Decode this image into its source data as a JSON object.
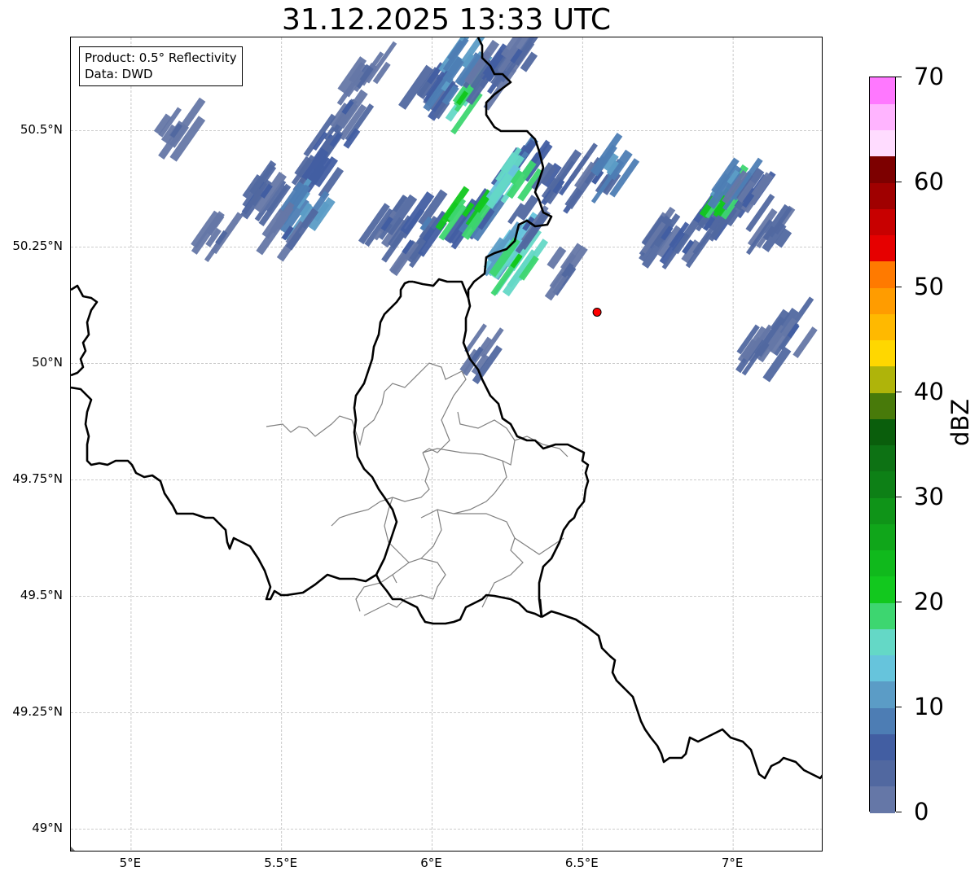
{
  "title": "31.12.2025 13:33 UTC",
  "info_box": {
    "product": "Product: 0.5° Reflectivity",
    "source": "Data: DWD"
  },
  "map": {
    "lon_range": [
      4.8,
      7.3
    ],
    "lat_range": [
      48.95,
      50.7
    ],
    "lat_ticks": [
      {
        "value": 50.5,
        "label": "50.5°N"
      },
      {
        "value": 50.25,
        "label": "50.25°N"
      },
      {
        "value": 50.0,
        "label": "50°N"
      },
      {
        "value": 49.75,
        "label": "49.75°N"
      },
      {
        "value": 49.5,
        "label": "49.5°N"
      },
      {
        "value": 49.25,
        "label": "49.25°N"
      },
      {
        "value": 49.0,
        "label": "49°N"
      }
    ],
    "lon_ticks": [
      {
        "value": 5.0,
        "label": "5°E"
      },
      {
        "value": 5.5,
        "label": "5.5°E"
      },
      {
        "value": 6.0,
        "label": "6°E"
      },
      {
        "value": 6.5,
        "label": "6.5°E"
      },
      {
        "value": 7.0,
        "label": "7°E"
      }
    ],
    "radar_site": {
      "lon": 6.548,
      "lat": 50.11,
      "color": "#ff0000"
    },
    "echo_cells": [
      {
        "lon": 5.78,
        "lat": 50.62,
        "dbz": 4
      },
      {
        "lon": 5.72,
        "lat": 50.55,
        "dbz": 5
      },
      {
        "lon": 5.68,
        "lat": 50.48,
        "dbz": 6
      },
      {
        "lon": 5.62,
        "lat": 50.4,
        "dbz": 7
      },
      {
        "lon": 5.58,
        "lat": 50.33,
        "dbz": 12
      },
      {
        "lon": 5.52,
        "lat": 50.28,
        "dbz": 5
      },
      {
        "lon": 5.45,
        "lat": 50.37,
        "dbz": 6
      },
      {
        "lon": 5.15,
        "lat": 50.5,
        "dbz": 4
      },
      {
        "lon": 5.3,
        "lat": 50.27,
        "dbz": 3
      },
      {
        "lon": 5.85,
        "lat": 50.3,
        "dbz": 6
      },
      {
        "lon": 5.92,
        "lat": 50.25,
        "dbz": 5
      },
      {
        "lon": 5.98,
        "lat": 50.3,
        "dbz": 8
      },
      {
        "lon": 6.0,
        "lat": 50.58,
        "dbz": 7
      },
      {
        "lon": 6.05,
        "lat": 50.6,
        "dbz": 10
      },
      {
        "lon": 6.12,
        "lat": 50.65,
        "dbz": 12
      },
      {
        "lon": 6.1,
        "lat": 50.57,
        "dbz": 20
      },
      {
        "lon": 6.2,
        "lat": 50.62,
        "dbz": 6
      },
      {
        "lon": 6.28,
        "lat": 50.66,
        "dbz": 5
      },
      {
        "lon": 6.15,
        "lat": 50.3,
        "dbz": 9
      },
      {
        "lon": 6.12,
        "lat": 50.33,
        "dbz": 22
      },
      {
        "lon": 6.25,
        "lat": 50.25,
        "dbz": 14
      },
      {
        "lon": 6.28,
        "lat": 50.22,
        "dbz": 20
      },
      {
        "lon": 6.32,
        "lat": 50.3,
        "dbz": 6
      },
      {
        "lon": 6.3,
        "lat": 50.44,
        "dbz": 9
      },
      {
        "lon": 6.28,
        "lat": 50.4,
        "dbz": 18
      },
      {
        "lon": 6.42,
        "lat": 50.38,
        "dbz": 7
      },
      {
        "lon": 6.55,
        "lat": 50.4,
        "dbz": 6
      },
      {
        "lon": 6.6,
        "lat": 50.42,
        "dbz": 12
      },
      {
        "lon": 6.45,
        "lat": 50.2,
        "dbz": 4
      },
      {
        "lon": 6.78,
        "lat": 50.28,
        "dbz": 5
      },
      {
        "lon": 6.85,
        "lat": 50.25,
        "dbz": 6
      },
      {
        "lon": 6.92,
        "lat": 50.3,
        "dbz": 7
      },
      {
        "lon": 6.97,
        "lat": 50.36,
        "dbz": 22
      },
      {
        "lon": 7.0,
        "lat": 50.4,
        "dbz": 12
      },
      {
        "lon": 7.05,
        "lat": 50.35,
        "dbz": 6
      },
      {
        "lon": 7.12,
        "lat": 50.28,
        "dbz": 4
      },
      {
        "lon": 7.2,
        "lat": 50.07,
        "dbz": 5
      },
      {
        "lon": 7.1,
        "lat": 50.03,
        "dbz": 4
      },
      {
        "lon": 6.15,
        "lat": 50.02,
        "dbz": 4
      }
    ]
  },
  "colorbar": {
    "unit": "dBZ",
    "min": 0,
    "max": 70,
    "ticks": [
      0,
      10,
      20,
      30,
      40,
      50,
      60,
      70
    ],
    "tick_labels": [
      "0",
      "10",
      "20",
      "30",
      "40",
      "50",
      "60",
      "70"
    ],
    "colors": [
      "#6577a7",
      "#5168a0",
      "#425ea2",
      "#4d7db4",
      "#5b9cc6",
      "#66c4dc",
      "#64d8c6",
      "#3dd670",
      "#12c81e",
      "#10b91c",
      "#10a61a",
      "#0f9418",
      "#0d8016",
      "#0d7214",
      "#0a5e0c",
      "#487a0a",
      "#afb40a",
      "#ffd700",
      "#ffb900",
      "#ff9c00",
      "#ff7a00",
      "#e60000",
      "#c80000",
      "#a00000",
      "#7d0000",
      "#ffdcff",
      "#ffb4ff",
      "#ff78ff",
      "#ee3cf0",
      "#ffffff"
    ]
  }
}
